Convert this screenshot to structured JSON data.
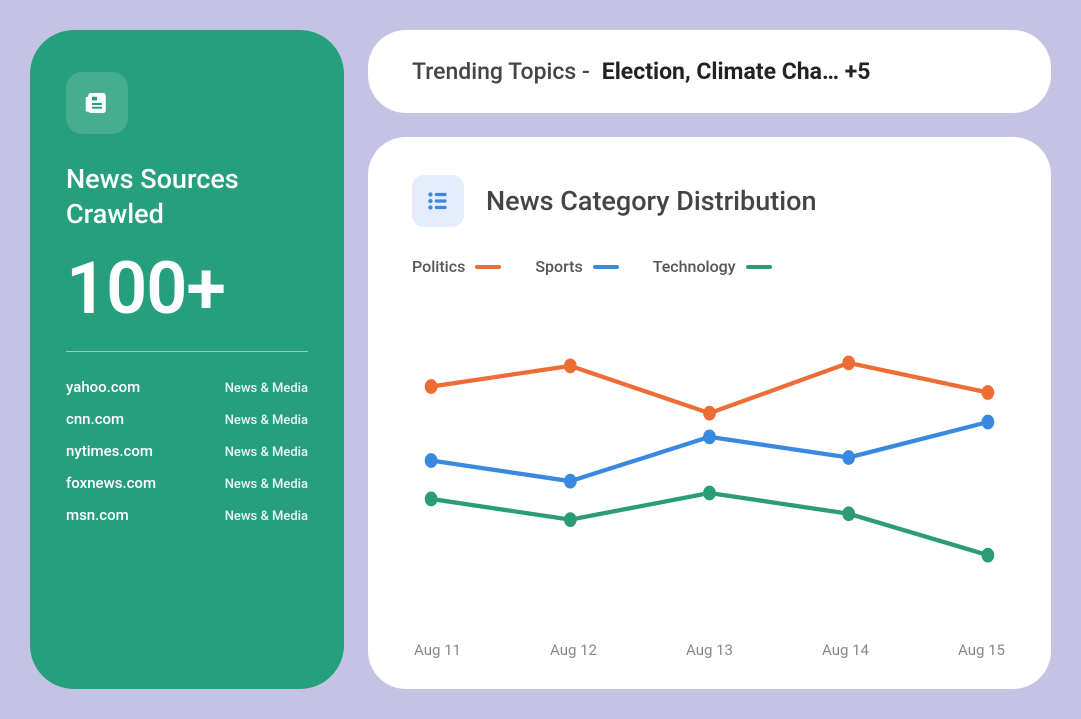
{
  "left": {
    "title": "News Sources Crawled",
    "count": "100+",
    "sources": [
      {
        "domain": "yahoo.com",
        "tag": "News & Media"
      },
      {
        "domain": "cnn.com",
        "tag": "News & Media"
      },
      {
        "domain": "nytimes.com",
        "tag": "News & Media"
      },
      {
        "domain": "foxnews.com",
        "tag": "News & Media"
      },
      {
        "domain": "msn.com",
        "tag": "News & Media"
      }
    ]
  },
  "topics": {
    "label": "Trending Topics -",
    "value": "Election, Climate Cha… +5"
  },
  "chart": {
    "title": "News Category Distribution"
  },
  "chart_data": {
    "type": "line",
    "categories": [
      "Aug 11",
      "Aug 12",
      "Aug 13",
      "Aug 14",
      "Aug 15"
    ],
    "series": [
      {
        "name": "Politics",
        "color": "#ed6d35",
        "values": [
          75,
          82,
          66,
          83,
          73
        ]
      },
      {
        "name": "Sports",
        "color": "#3a89e0",
        "values": [
          50,
          43,
          58,
          51,
          63
        ]
      },
      {
        "name": "Technology",
        "color": "#2a9d74",
        "values": [
          37,
          30,
          39,
          32,
          18
        ]
      }
    ],
    "ylim": [
      0,
      100
    ]
  }
}
